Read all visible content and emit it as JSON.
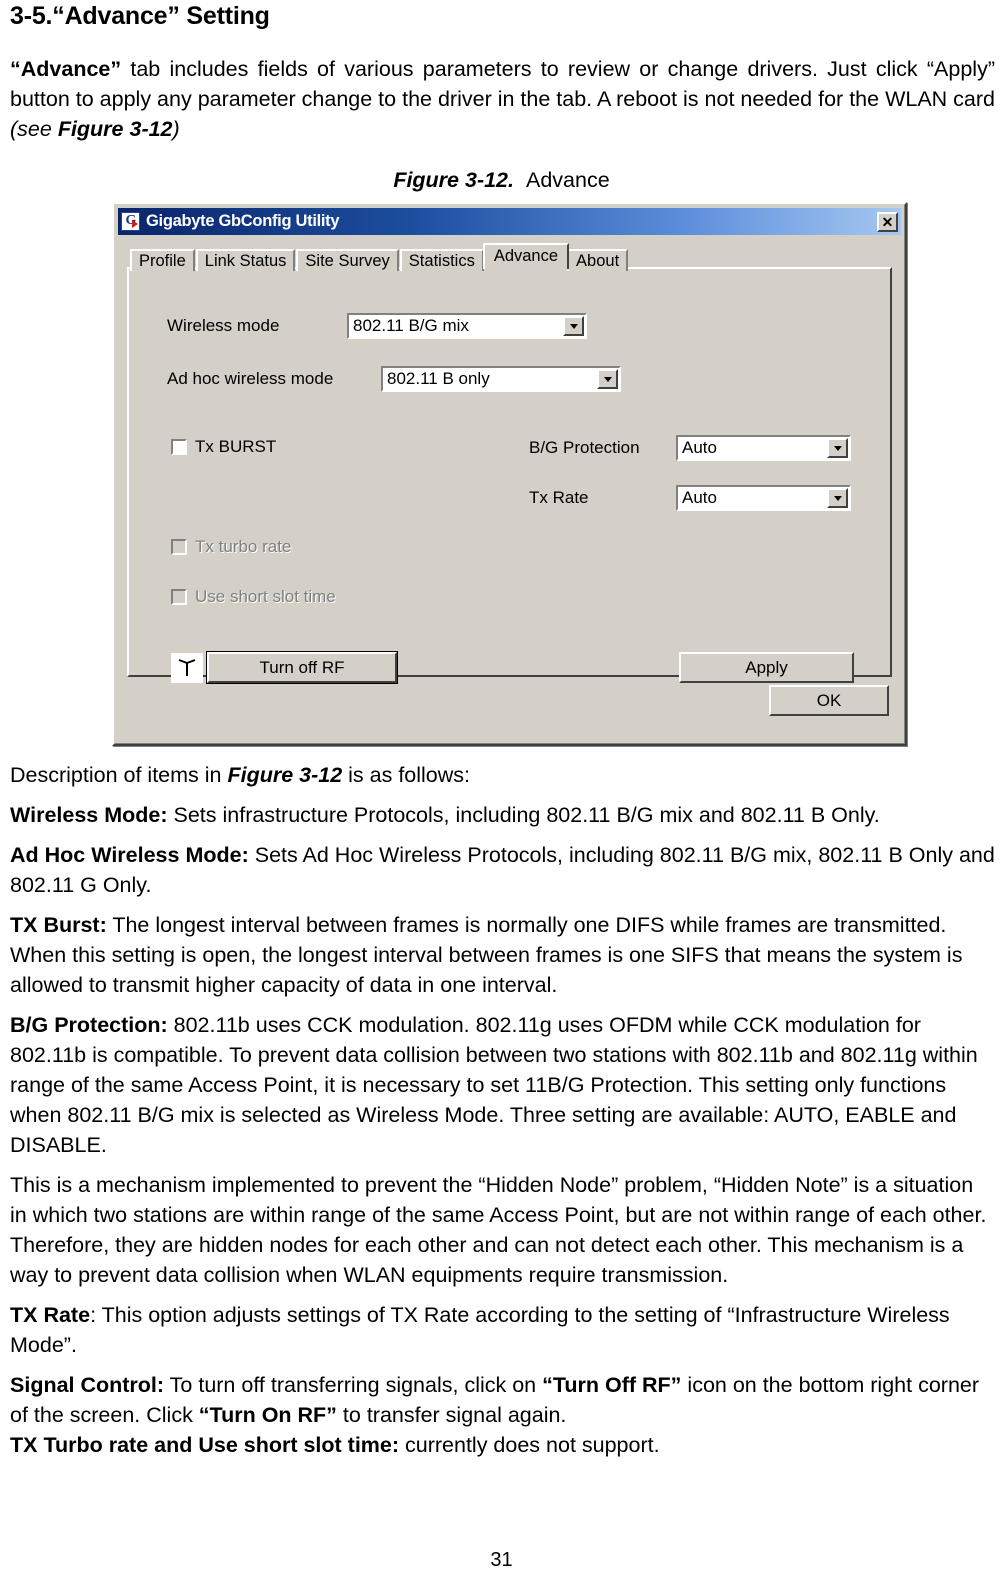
{
  "document": {
    "section_heading": "3-5.“Advance” Setting",
    "intro_paragraph": {
      "bold_lead": "“Advance”",
      "rest": " tab includes fields of various parameters to review or change drivers. Just click “Apply” button to apply any parameter change to the driver in the tab. A reboot is not needed for the WLAN card ",
      "italic_tail_prefix": "(see ",
      "italic_bold_ref": "Figure 3-12",
      "italic_tail_suffix": ")"
    },
    "figure_caption": {
      "number": "Figure 3-12.",
      "label": "Advance"
    },
    "desc_intro": {
      "prefix": "Description of items in ",
      "ref": "Figure 3-12",
      "suffix": " is as follows:"
    },
    "items": [
      {
        "term": "Wireless Mode:",
        "text": " Sets infrastructure Protocols, including 802.11 B/G mix and 802.11 B Only."
      },
      {
        "term": "Ad Hoc Wireless Mode:",
        "text": " Sets Ad Hoc Wireless Protocols, including 802.11 B/G mix, 802.11 B Only and 802.11 G Only."
      },
      {
        "term": "TX Burst:",
        "text": " The longest interval between frames is normally one DIFS while frames are transmitted. When this setting is open, the longest interval between frames is one SIFS that means the system is allowed to transmit higher capacity of data in one interval."
      },
      {
        "term": "B/G Protection:",
        "text": " 802.11b uses CCK modulation. 802.11g uses OFDM while CCK modulation for 802.11b is compatible. To prevent data collision between two stations with 802.11b and 802.11g within range of the same Access Point, it is necessary to set 11B/G Protection. This setting only functions when 802.11 B/G mix is selected as Wireless Mode. Three setting are available: AUTO, EABLE and DISABLE."
      }
    ],
    "hidden_node_paragraph": "This is a mechanism implemented to prevent the “Hidden Node” problem, “Hidden Note” is a situation in which two stations are within range of the same Access Point, but are not within range of each other. Therefore, they are hidden nodes for each other and can not detect each other. This mechanism is a way to prevent data collision when WLAN equipments require transmission.",
    "tx_rate_item": {
      "term": "TX Rate",
      "text": ": This option adjusts settings of TX Rate according to the setting of “Infrastructure Wireless Mode”."
    },
    "signal_control_item": {
      "term": "Signal Control:",
      "part1": " To turn off transferring signals, click on ",
      "bold1": "“Turn Off RF”",
      "part2": " icon on the bottom right corner of the screen. Click ",
      "bold2": "“Turn On RF”",
      "part3": " to transfer signal again."
    },
    "turbo_item": {
      "term": "TX Turbo rate and Use short slot time:",
      "text": " currently does not support."
    },
    "page_number": "31"
  },
  "dialog": {
    "title": "Gigabyte GbConfig Utility",
    "title_icon": "gigabyte-logo-icon",
    "logo_letter": "G",
    "close_label": "✕",
    "tabs": [
      {
        "label": "Profile",
        "active": false
      },
      {
        "label": "Link Status",
        "active": false
      },
      {
        "label": "Site Survey",
        "active": false
      },
      {
        "label": "Statistics",
        "active": false
      },
      {
        "label": "Advance",
        "active": true
      },
      {
        "label": "About",
        "active": false
      }
    ],
    "fields": {
      "wireless_mode": {
        "label": "Wireless mode",
        "value": "802.11 B/G mix"
      },
      "adhoc_wireless_mode": {
        "label": "Ad hoc wireless mode",
        "value": "802.11 B only"
      },
      "bg_protection": {
        "label": "B/G Protection",
        "value": "Auto"
      },
      "tx_rate": {
        "label": "Tx Rate",
        "value": "Auto"
      }
    },
    "checkboxes": {
      "tx_burst": {
        "label": "Tx BURST",
        "checked": false,
        "enabled": true
      },
      "tx_turbo_rate": {
        "label": "Tx turbo rate",
        "checked": false,
        "enabled": false
      },
      "use_short_slot_time": {
        "label": "Use short slot time",
        "checked": false,
        "enabled": false
      }
    },
    "buttons": {
      "turn_off_rf": "Turn off RF",
      "apply": "Apply",
      "ok": "OK"
    },
    "colors": {
      "face": "#d4d0c8",
      "titlebar_start": "#0a246a",
      "titlebar_end": "#a6c8f0",
      "text": "#000000",
      "disabled_text": "#808080"
    }
  }
}
